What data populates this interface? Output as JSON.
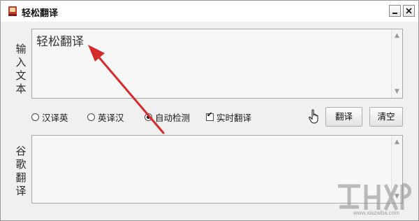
{
  "window": {
    "title": "轻松翻译",
    "icons": {
      "app": "app-book-icon",
      "minimize": "minimize-icon",
      "close": "close-icon"
    }
  },
  "input": {
    "side_label": "输入文本",
    "text": "轻松翻译"
  },
  "output": {
    "side_label": "谷歌翻译",
    "text": ""
  },
  "options": [
    {
      "label": "汉译英",
      "type": "radio",
      "checked": false
    },
    {
      "label": "英译汉",
      "type": "radio",
      "checked": false
    },
    {
      "label": "自动检测",
      "type": "radio",
      "checked": true
    },
    {
      "label": "实时翻译",
      "type": "checkbox",
      "checked": true
    }
  ],
  "buttons": {
    "translate_label": "翻译",
    "clear_label": "清空"
  },
  "colors": {
    "annotation_arrow": "#d62b2b",
    "window_bg": "#f0f0f0",
    "textbox_bg": "#f7f7f7"
  },
  "watermark": {
    "icon": "site-logo-watermark",
    "text": "www.xiazaiba.com"
  }
}
